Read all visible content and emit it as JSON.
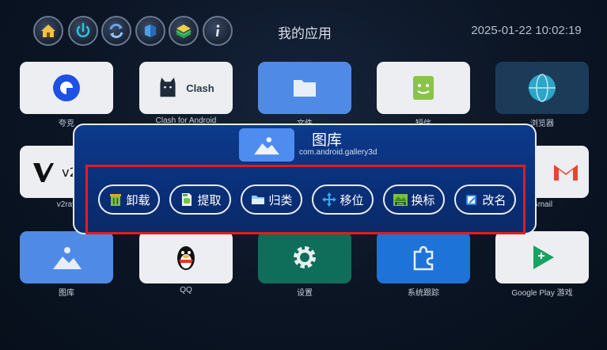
{
  "header": {
    "title": "我的应用",
    "datetime": "2025-01-22 10:02:19",
    "icons": [
      "home-icon",
      "power-icon",
      "refresh-icon",
      "cube-icon",
      "layers-icon",
      "info-icon"
    ]
  },
  "apps": {
    "row1": [
      "夸克",
      "Clash for Android",
      "文件",
      "短信",
      "浏览器"
    ],
    "row2": [
      "v2ray",
      "Gmail"
    ],
    "row3": [
      "图库",
      "QQ",
      "设置",
      "系统跟踪",
      "Google Play 游戏"
    ],
    "clash_text": "Clash",
    "v2_text": "v2"
  },
  "dialog": {
    "title": "图库",
    "package": "com.android.gallery3d",
    "actions": [
      {
        "label": "卸载",
        "icon": "trash-icon"
      },
      {
        "label": "提取",
        "icon": "apk-extract-icon"
      },
      {
        "label": "归类",
        "icon": "folder-icon"
      },
      {
        "label": "移位",
        "icon": "move-arrows-icon"
      },
      {
        "label": "换标",
        "icon": "png-image-icon"
      },
      {
        "label": "改名",
        "icon": "edit-icon"
      }
    ]
  },
  "colors": {
    "dialog_bg": "#0d3a8c",
    "highlight": "#e21d1d",
    "gallery_blue": "#4f8cf0"
  }
}
